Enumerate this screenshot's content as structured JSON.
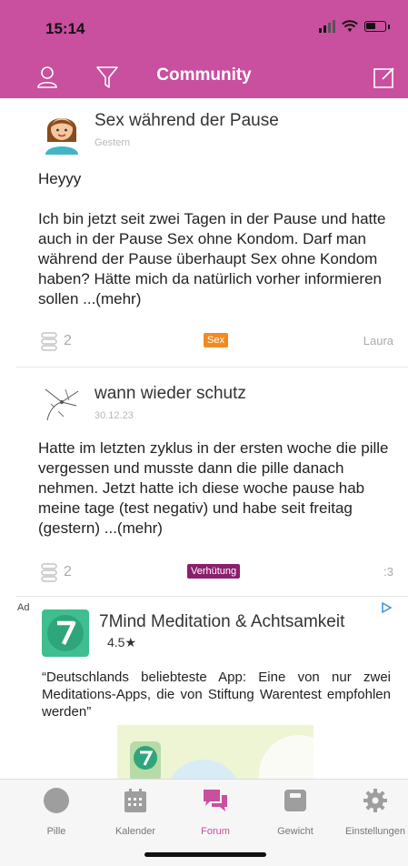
{
  "status": {
    "time": "15:14"
  },
  "header": {
    "title": "Community"
  },
  "posts": [
    {
      "title": "Sex während der Pause",
      "date": "Gestern",
      "greeting": "Heyyy",
      "body": "Ich bin jetzt seit zwei Tagen in der Pause und hatte auch in der Pause Sex ohne Kondom. Darf man während der Pause überhaupt Sex ohne Kondom haben? Hätte mich da natürlich vorher informieren sollen ...(mehr)",
      "comments": "2",
      "tag": "Sex",
      "tag_color": "#f28a1f",
      "author": "Laura"
    },
    {
      "title": "wann wieder schutz",
      "date": "30.12.23",
      "body": "Hatte im letzten zyklus in der ersten woche die pille vergessen und musste dann die pille danach nehmen. Jetzt hatte ich diese woche pause hab meine tage (test negativ) und habe seit freitag (gestern) ...(mehr)",
      "comments": "2",
      "tag": "Verhütung",
      "tag_color": "#8b1f6e",
      "author": ":3"
    }
  ],
  "ad": {
    "label": "Ad",
    "title": "7Mind Meditation & Achtsamkeit",
    "rating": "4.5★",
    "text": "“Deutschlands beliebteste App: Eine von nur zwei Meditations-Apps, die von Stiftung Warentest empfohlen werden”"
  },
  "tabs": [
    {
      "label": "Pille",
      "icon": "pill-circle-icon"
    },
    {
      "label": "Kalender",
      "icon": "calendar-icon"
    },
    {
      "label": "Forum",
      "icon": "chat-bubbles-icon",
      "active": true
    },
    {
      "label": "Gewicht",
      "icon": "scale-icon"
    },
    {
      "label": "Einstellungen",
      "icon": "gear-icon"
    }
  ],
  "colors": {
    "brand": "#c94f9f",
    "tab_inactive": "#777777"
  }
}
